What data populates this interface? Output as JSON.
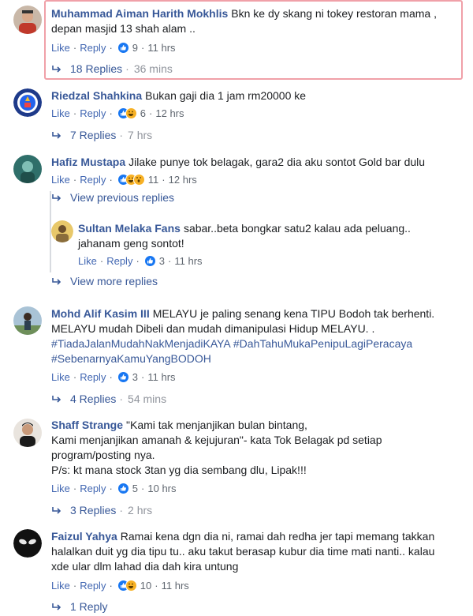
{
  "comments": [
    {
      "id": "c1",
      "name": "Muhammad Aiman Harith Mokhlis",
      "text_lines": [
        "Bkn ke dy skang ni tokey restoran mama ,",
        "depan masjid 13 shah alam .."
      ],
      "like": "Like",
      "reply": "Reply",
      "reaction_count": "9",
      "reaction_icons": [
        "like-icon"
      ],
      "time": "11 hrs",
      "replies_label": "18 Replies",
      "replies_time": "36 mins"
    },
    {
      "id": "c2",
      "name": "Riedzal Shahkina",
      "text_lines": [
        "Bukan gaji dia 1 jam rm20000 ke"
      ],
      "like": "Like",
      "reply": "Reply",
      "reaction_count": "6",
      "reaction_icons": [
        "like-icon",
        "haha-icon"
      ],
      "time": "12 hrs",
      "replies_label": "7 Replies",
      "replies_time": "7 hrs"
    },
    {
      "id": "c3",
      "name": "Hafiz Mustapa",
      "text_lines": [
        "Jilake punye tok belagak, gara2 dia aku sontot Gold bar dulu"
      ],
      "like": "Like",
      "reply": "Reply",
      "reaction_count": "11",
      "reaction_icons": [
        "like-icon",
        "haha-icon",
        "wow-icon"
      ],
      "time": "12 hrs",
      "view_previous": "View previous replies",
      "view_more": "View more replies",
      "reply_item": {
        "name": "Sultan Melaka Fans",
        "text_lines": [
          "sabar..beta bongkar satu2 kalau ada peluang..",
          "jahanam geng sontot!"
        ],
        "like": "Like",
        "reply": "Reply",
        "reaction_count": "3",
        "reaction_icons": [
          "like-icon"
        ],
        "time": "11 hrs"
      }
    },
    {
      "id": "c4",
      "name": "Mohd Alif Kasim III",
      "text_lines": [
        "MELAYU je paling senang kena TIPU Bodoh tak berhenti.",
        "MELAYU mudah Dibeli dan mudah dimanipulasi Hidup MELAYU. ."
      ],
      "hashtags": [
        "#TiadaJalanMudahNakMenjadiKAYA",
        "#DahTahuMukaPenipuLagiPeracaya",
        "#SebenarnyaKamuYangBODOH"
      ],
      "like": "Like",
      "reply": "Reply",
      "reaction_count": "3",
      "reaction_icons": [
        "like-icon"
      ],
      "time": "11 hrs",
      "replies_label": "4 Replies",
      "replies_time": "54 mins"
    },
    {
      "id": "c5",
      "name": "Shaff Strange",
      "text_lines": [
        "\"Kami tak menjanjikan bulan bintang,",
        "Kami menjanjikan amanah & kejujuran\"- kata Tok Belagak pd setiap",
        "program/posting nya.",
        "P/s: kt mana stock 3tan yg dia sembang dlu, Lipak!!!"
      ],
      "like": "Like",
      "reply": "Reply",
      "reaction_count": "5",
      "reaction_icons": [
        "like-icon"
      ],
      "time": "10 hrs",
      "replies_label": "3 Replies",
      "replies_time": "2 hrs"
    },
    {
      "id": "c6",
      "name": "Faizul Yahya",
      "text_lines": [
        "Ramai kena dgn dia ni, ramai dah redha jer tapi memang takkan",
        "halalkan duit yg dia tipu tu.. aku takut berasap kubur dia time mati nanti.. kalau",
        "xde ular dlm lahad dia dah kira untung"
      ],
      "like": "Like",
      "reply": "Reply",
      "reaction_count": "10",
      "reaction_icons": [
        "like-icon",
        "haha-icon"
      ],
      "time": "11 hrs",
      "replies_label": "1 Reply",
      "replies_time": ""
    }
  ],
  "colors": {
    "name": "#385898",
    "link": "#4267b2",
    "meta": "#606770",
    "highlight_border": "#f0a0a8",
    "like_blue": "#1877f2",
    "haha_yellow": "#f7b125"
  }
}
